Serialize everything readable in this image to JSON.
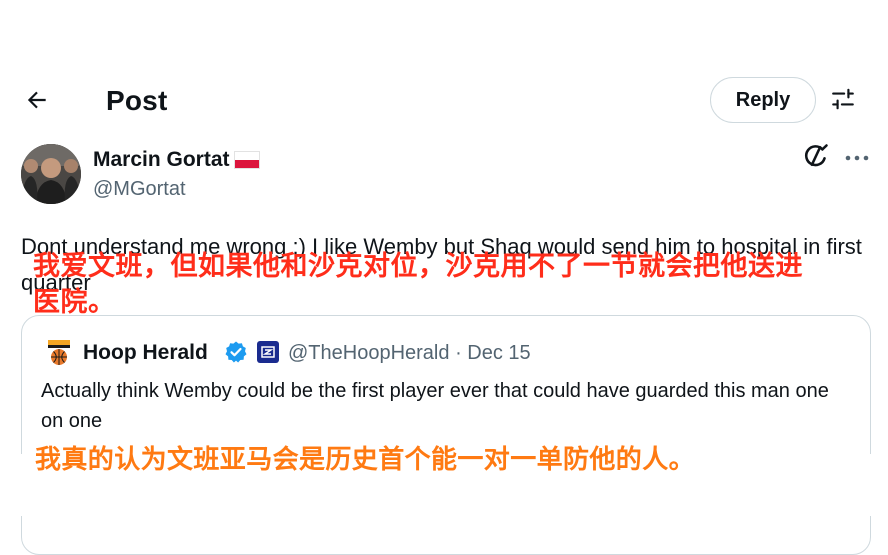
{
  "header": {
    "title": "Post",
    "reply_label": "Reply",
    "back_icon": "arrow-left-icon",
    "filter_icon": "sliders-icon"
  },
  "author": {
    "name": "Marcin Gortat",
    "handle": "@MGortat",
    "flag": "poland-flag"
  },
  "tweet": {
    "text": "Dont understand me wrong :) I like Wemby but Shaq would send him to hospital in first quarter"
  },
  "overlays": {
    "caption_1": "我爱文班，但如果他和沙克对位，沙克用不了一节就会把他送进医院。",
    "caption_1_color": "#ff2d1a",
    "caption_2": "我真的认为文班亚马会是历史首个能一对一单防他的人。",
    "caption_2_color": "#ff7a12"
  },
  "quote": {
    "name": "Hoop Herald",
    "handle": "@TheHoopHerald",
    "separator": "·",
    "date": "Dec 15",
    "text": "Actually think Wemby could be the first player ever that could have guarded this man one on one",
    "verified_color": "#1d9bf0"
  }
}
